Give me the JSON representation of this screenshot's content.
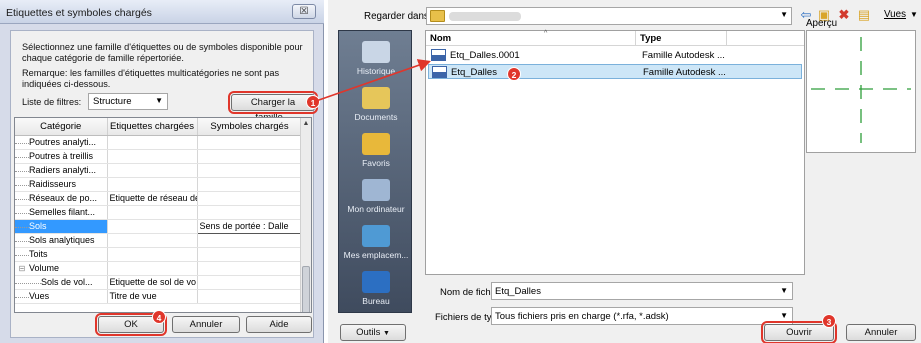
{
  "left_dialog": {
    "title": "Etiquettes et symboles chargés",
    "close_label": "☒",
    "description": "Sélectionnez une famille d'étiquettes ou de symboles disponible pour chaque catégorie de famille répertoriée.",
    "remark": "Remarque: les familles d'étiquettes multicatégories ne sont pas indiquées ci-dessous.",
    "filter_label": "Liste de filtres:",
    "filter_value": "Structure",
    "load_family_button": "Charger la famille...",
    "columns": [
      "Catégorie",
      "Etiquettes chargées",
      "Symboles chargés"
    ],
    "rows": [
      {
        "tree": "",
        "category": "Poutres analyti...",
        "tags": "",
        "symbols": ""
      },
      {
        "tree": "",
        "category": "Poutres à treillis",
        "tags": "",
        "symbols": ""
      },
      {
        "tree": "",
        "category": "Radiers analyti...",
        "tags": "",
        "symbols": ""
      },
      {
        "tree": "",
        "category": "Raidisseurs",
        "tags": "",
        "symbols": ""
      },
      {
        "tree": "",
        "category": "Réseaux de po...",
        "tags": "Etiquette de réseau de",
        "symbols": ""
      },
      {
        "tree": "",
        "category": "Semelles filant...",
        "tags": "",
        "symbols": ""
      },
      {
        "tree": "",
        "category": "Sols",
        "tags": "",
        "symbols": "Sens de portée : Dalle",
        "selected": true
      },
      {
        "tree": "",
        "category": "Sols analytiques",
        "tags": "",
        "symbols": ""
      },
      {
        "tree": "",
        "category": "Toits",
        "tags": "",
        "symbols": ""
      },
      {
        "tree": "⊟",
        "category": "Volume",
        "tags": "",
        "symbols": ""
      },
      {
        "tree": "",
        "category": "Sols de vol...",
        "tags": "Etiquette de sol de vo",
        "symbols": "",
        "indent": true
      },
      {
        "tree": "",
        "category": "Vues",
        "tags": "Titre de vue",
        "symbols": ""
      }
    ],
    "ok_button": "OK",
    "cancel_button": "Annuler",
    "help_button": "Aide"
  },
  "right_dialog": {
    "look_in_label": "Regarder dans:",
    "toolbar_icons": [
      "back-icon",
      "up-folder-icon",
      "delete-icon",
      "new-folder-icon"
    ],
    "views_label": "Vues",
    "preview_label": "Aperçu",
    "places": [
      {
        "label": "Historique",
        "icon": "history-icon",
        "color": "#c9d6e6"
      },
      {
        "label": "Documents",
        "icon": "documents-icon",
        "color": "#e6c65a"
      },
      {
        "label": "Favoris",
        "icon": "favorites-icon",
        "color": "#e8b83a"
      },
      {
        "label": "Mon ordinateur",
        "icon": "computer-icon",
        "color": "#9fb6d3"
      },
      {
        "label": "Mes emplacem...",
        "icon": "network-places-icon",
        "color": "#4f9ad4"
      },
      {
        "label": "Bureau",
        "icon": "desktop-icon",
        "color": "#2c6fc2"
      }
    ],
    "columns": [
      "Nom",
      "Type"
    ],
    "files": [
      {
        "name": "Etq_Dalles.0001",
        "type": "Famille Autodesk ..."
      },
      {
        "name": "Etq_Dalles",
        "type": "Famille Autodesk ...",
        "selected": true
      }
    ],
    "file_name_label": "Nom de fichier:",
    "file_name_value": "Etq_Dalles",
    "file_type_label": "Fichiers de type:",
    "file_type_value": "Tous fichiers pris en charge  (*.rfa, *.adsk)",
    "tools_button": "Outils",
    "open_button": "Ouvrir",
    "cancel_button": "Annuler"
  },
  "steps": [
    "1",
    "2",
    "3",
    "4"
  ],
  "colors": {
    "highlight": "#e0362b",
    "selection": "#3399ff",
    "preview_cross": "#2e9e3a"
  }
}
